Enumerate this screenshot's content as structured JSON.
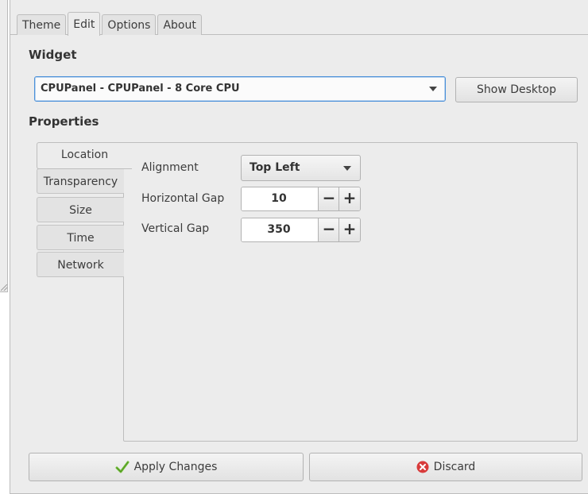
{
  "tabs": [
    {
      "label": "Theme",
      "active": false
    },
    {
      "label": "Edit",
      "active": true
    },
    {
      "label": "Options",
      "active": false
    },
    {
      "label": "About",
      "active": false
    }
  ],
  "widget_section": {
    "title": "Widget",
    "selected_widget": "CPUPanel - CPUPanel - 8 Core CPU",
    "show_desktop_label": "Show Desktop"
  },
  "properties_section": {
    "title": "Properties",
    "side_tabs": [
      {
        "label": "Location",
        "active": true
      },
      {
        "label": "Transparency",
        "active": false
      },
      {
        "label": "Size",
        "active": false
      },
      {
        "label": "Time",
        "active": false
      },
      {
        "label": "Network",
        "active": false
      }
    ],
    "alignment": {
      "label": "Alignment",
      "value": "Top Left"
    },
    "horizontal_gap": {
      "label": "Horizontal Gap",
      "value": "10"
    },
    "vertical_gap": {
      "label": "Vertical Gap",
      "value": "350"
    },
    "minus_symbol": "−",
    "plus_symbol": "+"
  },
  "footer": {
    "apply_label": "Apply Changes",
    "discard_label": "Discard"
  },
  "icons": {
    "apply": "check-icon",
    "discard": "discard-icon",
    "dropdown": "chevron-down-icon"
  },
  "colors": {
    "focus_border": "#4a90d9",
    "check_green": "#73c03a",
    "discard_red": "#d83b3b"
  }
}
